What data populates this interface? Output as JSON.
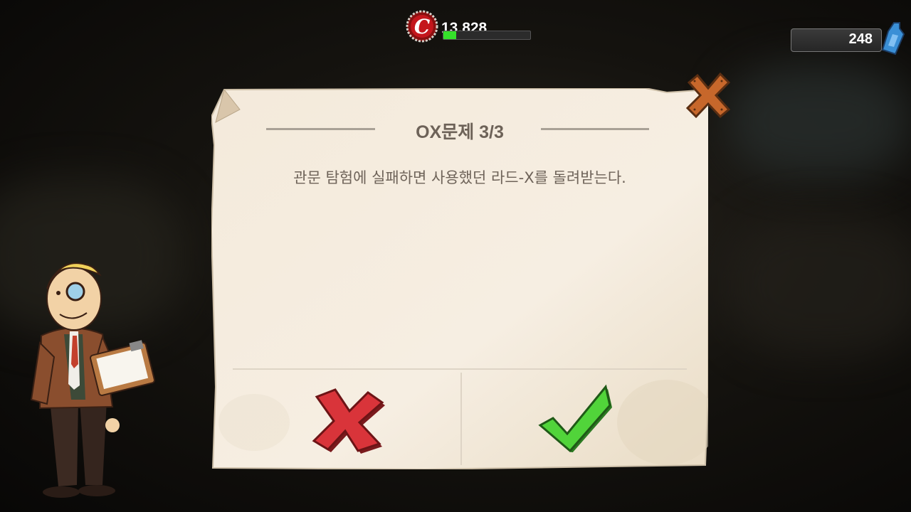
{
  "hud": {
    "caps_value": "13,828",
    "caps_progress": 0.15,
    "caps_icon": "bottle-cap-icon",
    "nuka_value": "248",
    "nuka_icon": "nuka-quantum-icon"
  },
  "dialog": {
    "title": "OX문제 3/3",
    "question": "관문 탐험에 실패하면 사용했던 라드-X를 돌려받는다.",
    "close_icon": "close-icon",
    "answer_false_icon": "x-mark-icon",
    "answer_true_icon": "check-mark-icon"
  },
  "colors": {
    "parchment": "#f3e8d6",
    "text": "#6d6258",
    "x_red": "#d9343a",
    "check_green": "#51d43a",
    "close_orange": "#c7672b",
    "caps_bar": "#35e12a"
  }
}
